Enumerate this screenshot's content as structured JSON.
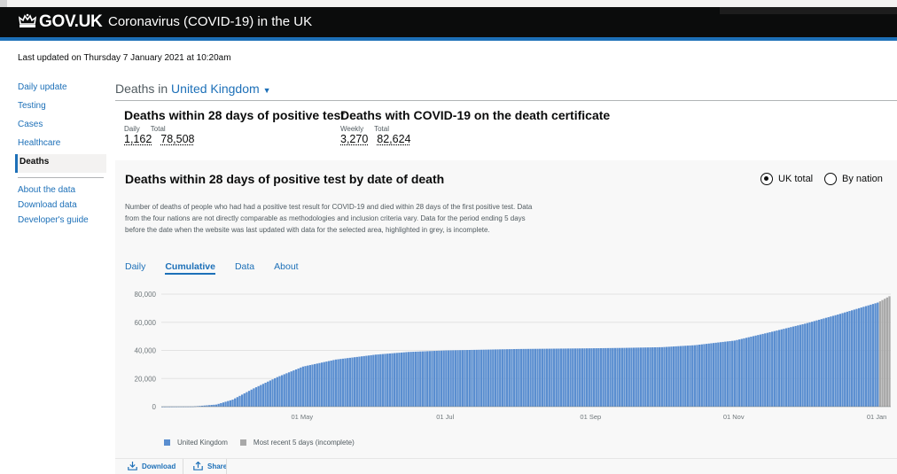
{
  "header": {
    "brand": "GOV.UK",
    "service": "Coronavirus (COVID-19) in the UK"
  },
  "last_updated": "Last updated on Thursday 7 January 2021 at 10:20am",
  "sidebar": {
    "items": [
      {
        "label": "Daily update"
      },
      {
        "label": "Testing"
      },
      {
        "label": "Cases"
      },
      {
        "label": "Healthcare"
      },
      {
        "label": "Deaths",
        "active": true
      }
    ],
    "secondary": [
      {
        "label": "About the data"
      },
      {
        "label": "Download data"
      },
      {
        "label": "Developer's guide"
      }
    ]
  },
  "page": {
    "deaths_in": "Deaths in",
    "location": "United Kingdom"
  },
  "headline": {
    "left": {
      "title": "Deaths within 28 days of positive test",
      "label1": "Daily",
      "label2": "Total",
      "value1": "1,162",
      "value2": "78,508"
    },
    "right": {
      "title": "Deaths with COVID-19 on the death certificate",
      "label1": "Weekly",
      "label2": "Total",
      "value1": "3,270",
      "value2": "82,624"
    }
  },
  "card": {
    "title": "Deaths within 28 days of positive test by date of death",
    "radio_uk": "UK total",
    "radio_nation": "By nation",
    "description": "Number of deaths of people who had had a positive test result for COVID-19 and died within 28 days of the first positive test. Data from the four nations are not directly comparable as methodologies and inclusion criteria vary. Data for the period ending 5 days before the date when the website was last updated with data for the selected area, highlighted in grey, is incomplete.",
    "tabs": [
      "Daily",
      "Cumulative",
      "Data",
      "About"
    ],
    "active_tab": "Cumulative",
    "download": "Download",
    "share": "Share"
  },
  "chart_data": {
    "type": "bar",
    "y_ticks": [
      "80,000",
      "60,000",
      "40,000",
      "20,000",
      "0"
    ],
    "ylim": [
      0,
      80000
    ],
    "x_ticks": [
      "01 May",
      "01 Jul",
      "01 Sep",
      "01 Nov",
      "01 Jan"
    ],
    "x_range": [
      "2020-03-02",
      "2021-01-06"
    ],
    "series": [
      {
        "name": "United Kingdom",
        "color": "#5a8ed0"
      },
      {
        "name": "Most recent 5 days (incomplete)",
        "color": "#a8a8a8"
      }
    ],
    "cumulative_values": [
      {
        "date": "2020-03-02",
        "value": 0
      },
      {
        "date": "2020-03-15",
        "value": 100
      },
      {
        "date": "2020-03-25",
        "value": 1500
      },
      {
        "date": "2020-04-01",
        "value": 5000
      },
      {
        "date": "2020-04-10",
        "value": 13000
      },
      {
        "date": "2020-04-20",
        "value": 21000
      },
      {
        "date": "2020-05-01",
        "value": 28500
      },
      {
        "date": "2020-05-15",
        "value": 33500
      },
      {
        "date": "2020-06-01",
        "value": 37000
      },
      {
        "date": "2020-06-15",
        "value": 38900
      },
      {
        "date": "2020-07-01",
        "value": 40000
      },
      {
        "date": "2020-08-01",
        "value": 41000
      },
      {
        "date": "2020-09-01",
        "value": 41500
      },
      {
        "date": "2020-09-15",
        "value": 41800
      },
      {
        "date": "2020-10-01",
        "value": 42300
      },
      {
        "date": "2020-10-15",
        "value": 43700
      },
      {
        "date": "2020-11-01",
        "value": 47000
      },
      {
        "date": "2020-11-15",
        "value": 52500
      },
      {
        "date": "2020-12-01",
        "value": 59000
      },
      {
        "date": "2020-12-15",
        "value": 65500
      },
      {
        "date": "2021-01-01",
        "value": 74000
      },
      {
        "date": "2021-01-06",
        "value": 78508
      }
    ],
    "incomplete_days": 5
  }
}
